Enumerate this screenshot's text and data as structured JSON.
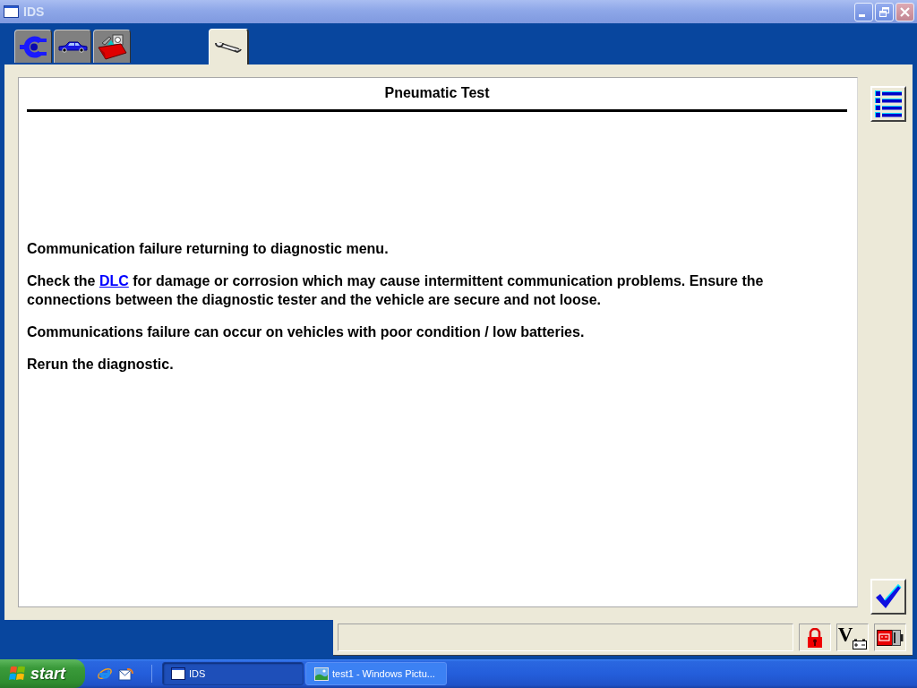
{
  "window": {
    "title": "IDS"
  },
  "tabs": [
    {
      "kind": "connector",
      "selected": false
    },
    {
      "kind": "vehicle",
      "selected": false
    },
    {
      "kind": "toolbox",
      "selected": false
    },
    {
      "kind": "wrench",
      "selected": true
    }
  ],
  "page": {
    "title": "Pneumatic Test",
    "paragraphs": [
      {
        "parts": [
          {
            "kind": "text",
            "text": "Communication failure returning to diagnostic menu."
          }
        ]
      },
      {
        "parts": [
          {
            "kind": "text",
            "text": "Check the "
          },
          {
            "kind": "link",
            "text": "DLC"
          },
          {
            "kind": "text",
            "text": " for damage or corrosion which may cause intermittent communication problems. Ensure the connections between the diagnostic tester and the vehicle are secure and not loose."
          }
        ]
      },
      {
        "parts": [
          {
            "kind": "text",
            "text": "Communications failure can occur on vehicles with poor condition / low batteries."
          }
        ]
      },
      {
        "parts": [
          {
            "kind": "text",
            "text": "Rerun the diagnostic."
          }
        ]
      }
    ]
  },
  "status_bar": {
    "voltage_symbol": "V"
  },
  "taskbar": {
    "start_label": "start",
    "tasks": [
      {
        "kind": "window",
        "label": "IDS",
        "selected": true
      },
      {
        "kind": "picture",
        "label": "test1 - Windows Pictu...",
        "selected": false
      }
    ]
  }
}
